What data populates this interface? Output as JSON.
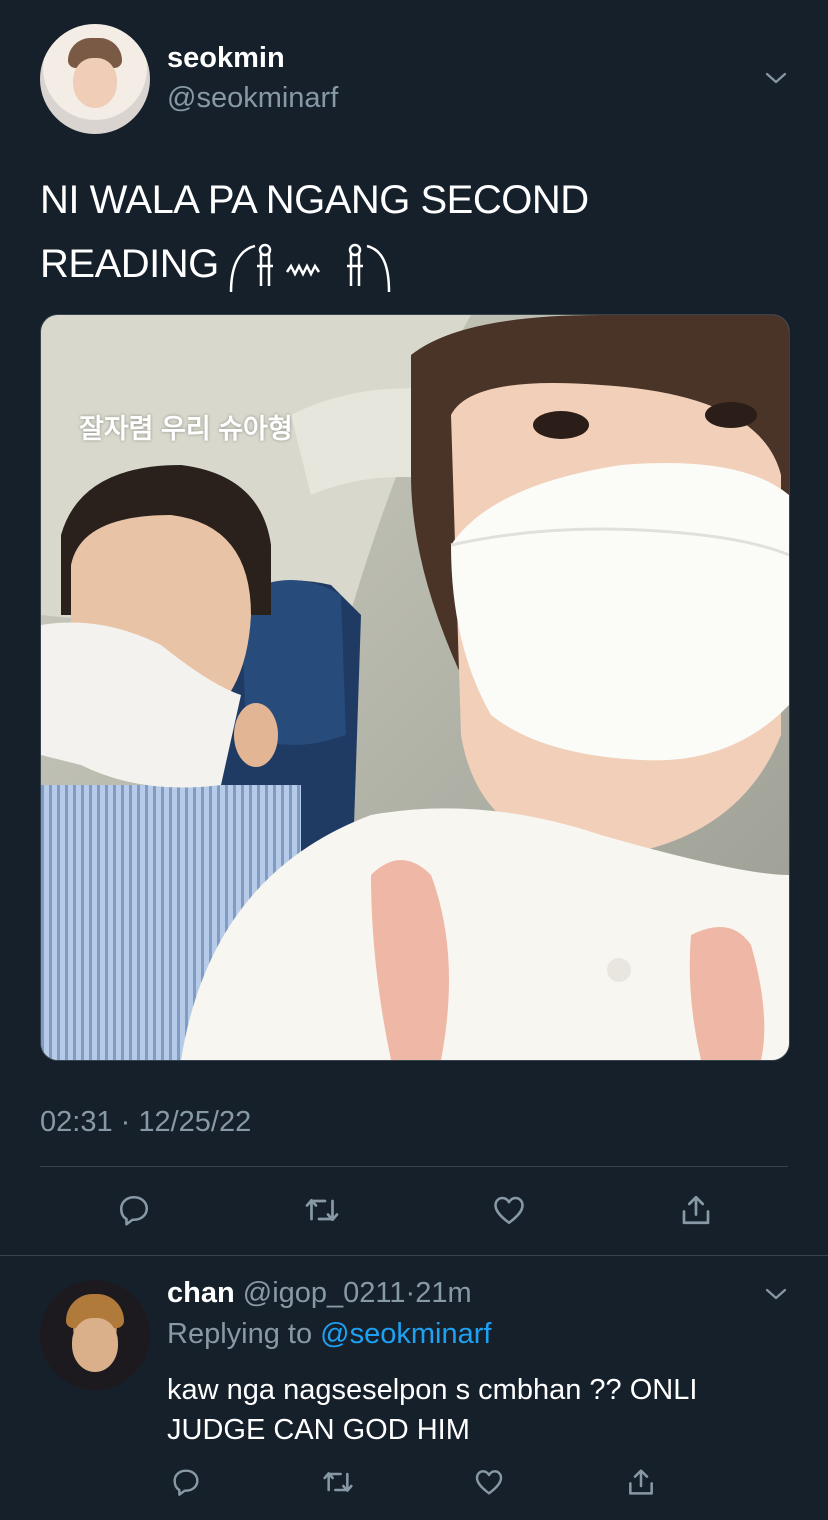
{
  "tweet": {
    "display_name": "seokmin",
    "handle": "@seokminarf",
    "text_line1": "NI WALA PA NGANG SECOND",
    "text_line2": "READING",
    "emoji_text": "╭ₘ ᵐᵐᵐ ₘ╮",
    "media_caption": "잘자렴 우리 슈아형",
    "timestamp": "02:31 · 12/25/22",
    "actions": [
      "reply-icon",
      "retweet-icon",
      "like-icon",
      "share-icon"
    ]
  },
  "reply": {
    "display_name": "chan",
    "handle": "@igop_0211",
    "separator": "·",
    "time": "21m",
    "replying_prefix": "Replying to",
    "replying_mention": "@seokminarf",
    "text": "kaw nga nagseselpon s cmbhan ?? ONLI JUDGE CAN GOD HIM",
    "actions": [
      "reply-icon",
      "retweet-icon",
      "like-icon",
      "share-icon"
    ]
  },
  "colors": {
    "background": "#15202b",
    "secondary_text": "#8899a6",
    "accent": "#1da1f2",
    "divider": "#38444d"
  }
}
